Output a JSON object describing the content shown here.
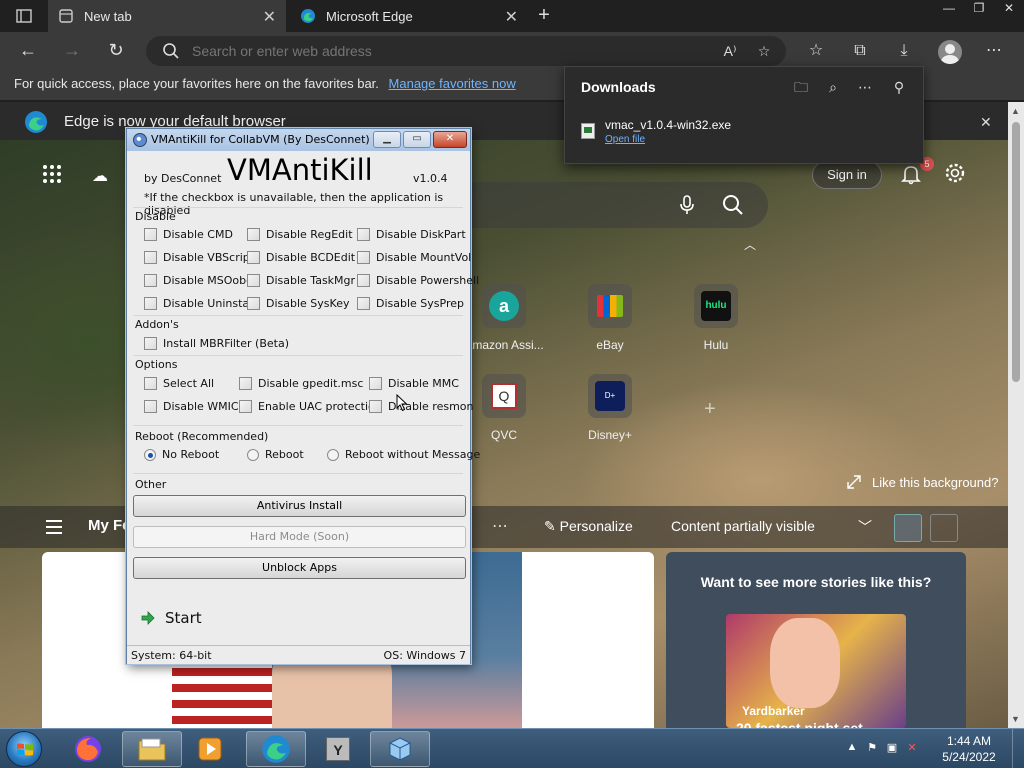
{
  "browser": {
    "tabs": [
      {
        "label": "New tab",
        "active": true
      },
      {
        "label": "Microsoft Edge",
        "active": false
      }
    ],
    "address_placeholder": "Search or enter web address",
    "favbar_text": "For quick access, place your favorites here on the favorites bar.",
    "favbar_link": "Manage favorites now",
    "infobar_text": "Edge is now your default browser"
  },
  "downloads": {
    "title": "Downloads",
    "file_name": "vmac_v1.0.4-win32.exe",
    "open_file": "Open file"
  },
  "newtab": {
    "signin": "Sign in",
    "notif_count": "5",
    "tiles": [
      {
        "label": "Amazon Assi...",
        "icon": "amazon-icon"
      },
      {
        "label": "eBay",
        "icon": "ebay-icon"
      },
      {
        "label": "Hulu",
        "icon": "hulu-icon"
      },
      {
        "label": "QVC",
        "icon": "qvc-icon"
      },
      {
        "label": "Disney+",
        "icon": "disney-icon"
      }
    ],
    "like_bg": "Like this background?",
    "feed": {
      "my_feed": "My Fe",
      "personalize": "Personalize",
      "content_visible": "Content partially visible"
    },
    "promo": {
      "heading": "Want to see more stories like this?",
      "source": "Yardbarker",
      "title_fragment": "20 fastest night set"
    }
  },
  "dialog": {
    "title": "VMAntiKill for CollabVM (By DesConnet)",
    "app_name": "VMAntiKill",
    "byline": "by DesConnet",
    "version": "v1.0.4",
    "note": "*If the checkbox is unavailable, then the application is disabled",
    "sections": {
      "disable": "Disable",
      "addons": "Addon's",
      "options": "Options",
      "reboot": "Reboot (Recommended)",
      "other": "Other"
    },
    "disable_items": [
      "Disable CMD",
      "Disable RegEdit",
      "Disable DiskPart",
      "Disable VBScript",
      "Disable BCDEdit",
      "Disable MountVol",
      "Disable MSOobe",
      "Disable TaskMgr",
      "Disable Powershell",
      "Disable Uninstall",
      "Disable SysKey",
      "Disable SysPrep"
    ],
    "addon_items": [
      "Install MBRFilter (Beta)"
    ],
    "option_items": [
      "Select All",
      "Disable gpedit.msc",
      "Disable MMC",
      "Disable WMIC",
      "Enable UAC protection",
      "Disable resmon"
    ],
    "reboot_options": [
      "No Reboot",
      "Reboot",
      "Reboot without Message"
    ],
    "reboot_selected": "No Reboot",
    "buttons": {
      "antivirus": "Antivirus Install",
      "hardmode": "Hard Mode (Soon)",
      "unblock": "Unblock Apps"
    },
    "start": "Start",
    "status_system": "System: 64-bit",
    "status_os": "OS: Windows 7"
  },
  "taskbar": {
    "time": "1:44 AM",
    "date": "5/24/2022"
  }
}
